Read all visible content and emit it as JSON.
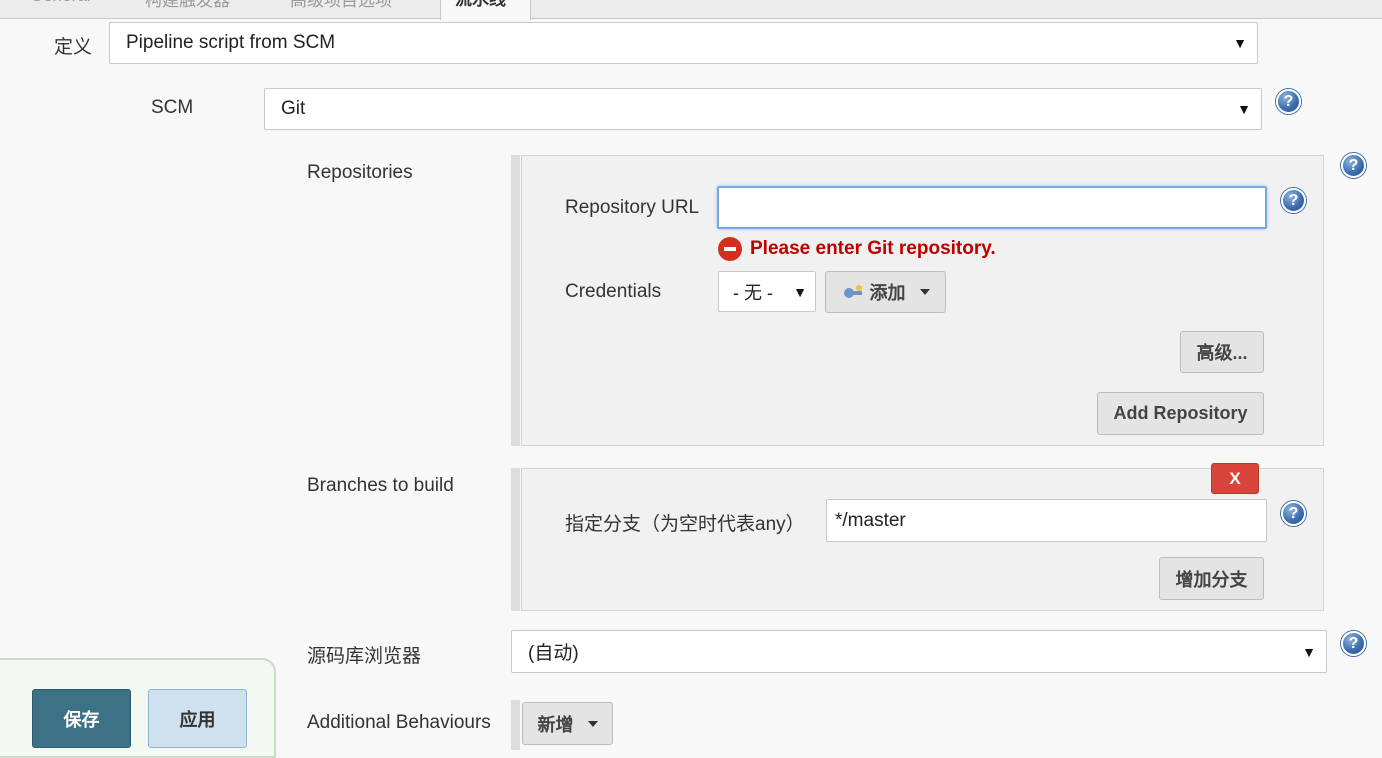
{
  "tabs": [
    {
      "label": "General"
    },
    {
      "label": "构建触发器"
    },
    {
      "label": "高级项目选项"
    },
    {
      "label": "流水线",
      "active": true
    }
  ],
  "definition": {
    "label": "定义",
    "value": "Pipeline script from SCM"
  },
  "scm": {
    "label": "SCM",
    "value": "Git"
  },
  "repositories": {
    "label": "Repositories",
    "url_label": "Repository URL",
    "url_value": "",
    "error": "Please enter Git repository.",
    "credentials_label": "Credentials",
    "credentials_value": "- 无 -",
    "add_label": "添加",
    "advanced_label": "高级...",
    "add_repo_label": "Add Repository"
  },
  "branches": {
    "label": "Branches to build",
    "delete_label": "X",
    "spec_label": "指定分支（为空时代表any）",
    "spec_value": "*/master",
    "add_branch_label": "增加分支"
  },
  "browser": {
    "label": "源码库浏览器",
    "value": "(自动)"
  },
  "behaviours": {
    "label": "Additional Behaviours",
    "add_label": "新增"
  },
  "footer": {
    "save_label": "保存",
    "apply_label": "应用"
  },
  "icons": {
    "help": "help-icon",
    "error": "error-icon",
    "credentials": "key-icon"
  },
  "colors": {
    "error": "#c00000",
    "save": "#3d7185",
    "delete": "#d9453a"
  }
}
